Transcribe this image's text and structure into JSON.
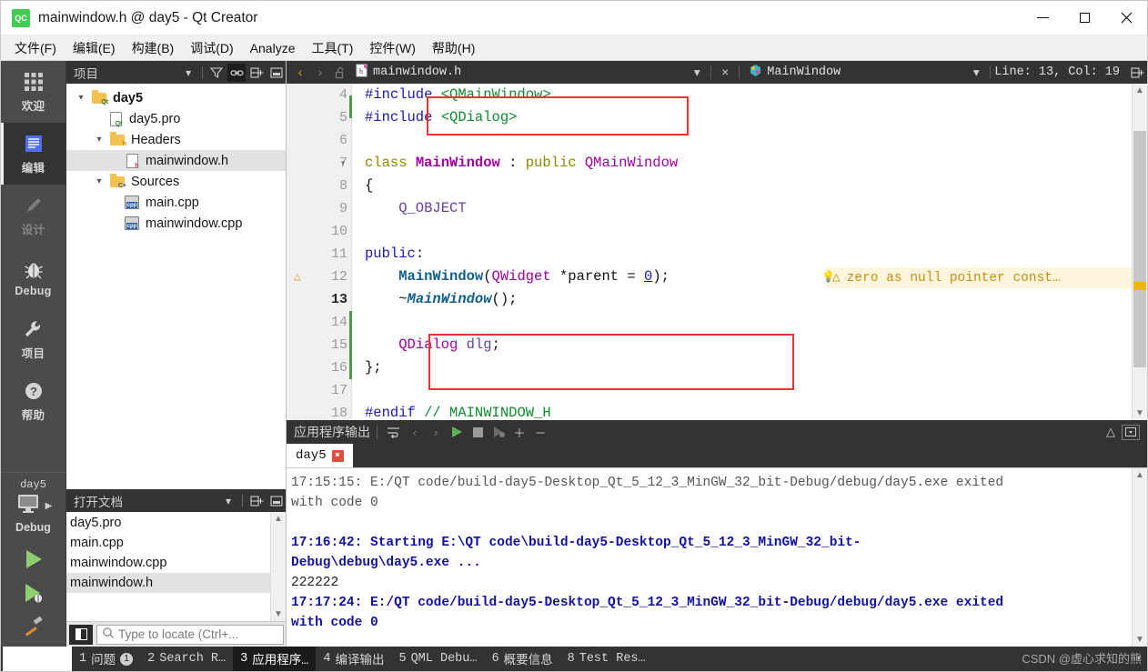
{
  "window": {
    "title": "mainwindow.h @ day5 - Qt Creator",
    "logo_text": "QC",
    "minimize_label": "minimize",
    "maximize_label": "maximize",
    "close_label": "close"
  },
  "menubar": [
    {
      "label": "文件(F)"
    },
    {
      "label": "编辑(E)"
    },
    {
      "label": "构建(B)"
    },
    {
      "label": "调试(D)"
    },
    {
      "label": "Analyze"
    },
    {
      "label": "工具(T)"
    },
    {
      "label": "控件(W)"
    },
    {
      "label": "帮助(H)"
    }
  ],
  "modebar": {
    "modes": [
      {
        "label": "欢迎",
        "icon": "grid-icon",
        "state": "normal"
      },
      {
        "label": "编辑",
        "icon": "edit-lines-icon",
        "state": "active"
      },
      {
        "label": "设计",
        "icon": "pencil-icon",
        "state": "disabled"
      },
      {
        "label": "Debug",
        "icon": "bug-icon",
        "state": "normal"
      },
      {
        "label": "项目",
        "icon": "wrench-icon",
        "state": "normal"
      },
      {
        "label": "帮助",
        "icon": "question-icon",
        "state": "normal"
      }
    ],
    "kit": {
      "project": "day5",
      "build_mode": "Debug",
      "target_icon": "monitor-icon"
    },
    "run_buttons": [
      {
        "name": "run-button",
        "icon": "play-icon"
      },
      {
        "name": "debug-button",
        "icon": "play-bug-icon"
      },
      {
        "name": "build-button",
        "icon": "hammer-icon"
      }
    ]
  },
  "project_pane": {
    "title": "项目",
    "toolbar": [
      {
        "name": "filter-icon"
      },
      {
        "name": "link-icon"
      },
      {
        "name": "split-icon"
      },
      {
        "name": "close-pane-icon"
      }
    ],
    "tree": [
      {
        "label": "day5",
        "indent": 0,
        "twisty": "v",
        "icon": "qt-folder-icon",
        "bold": true,
        "selected": false
      },
      {
        "label": "day5.pro",
        "indent": 1,
        "twisty": "",
        "icon": "pro-file-icon",
        "bold": false,
        "selected": false
      },
      {
        "label": "Headers",
        "indent": 1,
        "twisty": "v",
        "icon": "h-folder-icon",
        "bold": false,
        "selected": false
      },
      {
        "label": "mainwindow.h",
        "indent": 2,
        "twisty": "",
        "icon": "h-file-icon",
        "bold": false,
        "selected": true
      },
      {
        "label": "Sources",
        "indent": 1,
        "twisty": "v",
        "icon": "cpp-folder-icon",
        "bold": false,
        "selected": false
      },
      {
        "label": "main.cpp",
        "indent": 2,
        "twisty": "",
        "icon": "cpp-file-icon",
        "bold": false,
        "selected": false
      },
      {
        "label": "mainwindow.cpp",
        "indent": 2,
        "twisty": "",
        "icon": "cpp-file-icon",
        "bold": false,
        "selected": false
      }
    ]
  },
  "open_documents": {
    "title": "打开文档",
    "items": [
      {
        "label": "day5.pro",
        "selected": false
      },
      {
        "label": "main.cpp",
        "selected": false
      },
      {
        "label": "mainwindow.cpp",
        "selected": false
      },
      {
        "label": "mainwindow.h",
        "selected": true
      }
    ]
  },
  "locator": {
    "placeholder": "Type to locate (Ctrl+...",
    "icon": "search-icon",
    "toggle_icon": "sidebar-toggle-icon"
  },
  "editor_toolbar": {
    "back_label": "‹",
    "forward_label": "›",
    "lock_icon": "unlock-icon",
    "file_icon": "h-file-icon",
    "file_name": "mainwindow.h",
    "close_label": "×",
    "symbol_icon": "class-icon",
    "symbol_name": "MainWindow",
    "position": "Line: 13, Col: 19",
    "split_icon": "split-icon"
  },
  "code": {
    "lines": [
      {
        "no": "4",
        "marker": "",
        "fold": "",
        "current": false,
        "changed": false,
        "tokens": [
          {
            "t": "#include ",
            "c": "k-pre"
          },
          {
            "t": "<QMainWindow>",
            "c": "k-str"
          }
        ]
      },
      {
        "no": "5",
        "marker": "",
        "fold": "",
        "current": false,
        "changed": false,
        "cursor": true,
        "tokens": [
          {
            "t": "#include ",
            "c": "k-pre"
          },
          {
            "t": "<QDialog>",
            "c": "k-str"
          }
        ]
      },
      {
        "no": "6",
        "marker": "",
        "fold": "",
        "current": false,
        "changed": false,
        "tokens": []
      },
      {
        "no": "7",
        "marker": "",
        "fold": "v",
        "current": false,
        "changed": false,
        "tokens": [
          {
            "t": "class ",
            "c": "k-key"
          },
          {
            "t": "MainWindow",
            "c": "k-type"
          },
          {
            "t": " : ",
            "c": "k-plain"
          },
          {
            "t": "public ",
            "c": "k-key"
          },
          {
            "t": "QMainWindow",
            "c": "k-typen"
          }
        ]
      },
      {
        "no": "8",
        "marker": "",
        "fold": "",
        "current": false,
        "changed": false,
        "tokens": [
          {
            "t": "{",
            "c": "k-plain"
          }
        ]
      },
      {
        "no": "9",
        "marker": "",
        "fold": "",
        "current": false,
        "changed": false,
        "tokens": [
          {
            "t": "    Q_OBJECT",
            "c": "k-var"
          }
        ]
      },
      {
        "no": "10",
        "marker": "",
        "fold": "",
        "current": false,
        "changed": false,
        "tokens": []
      },
      {
        "no": "11",
        "marker": "",
        "fold": "",
        "current": false,
        "changed": false,
        "tokens": [
          {
            "t": "public",
            "c": "k-pre"
          },
          {
            "t": ":",
            "c": "k-plain"
          }
        ]
      },
      {
        "no": "12",
        "marker": "warn",
        "fold": "",
        "current": false,
        "changed": false,
        "tokens": [
          {
            "t": "    ",
            "c": "k-plain"
          },
          {
            "t": "MainWindow",
            "c": "k-fn"
          },
          {
            "t": "(",
            "c": "k-plain"
          },
          {
            "t": "QWidget",
            "c": "k-typen"
          },
          {
            "t": " *parent = ",
            "c": "k-plain"
          },
          {
            "t": "0",
            "c": "k-num"
          },
          {
            "t": ");",
            "c": "k-plain"
          }
        ]
      },
      {
        "no": "13",
        "marker": "",
        "fold": "",
        "current": true,
        "changed": false,
        "tokens": [
          {
            "t": "    ~",
            "c": "k-plain"
          },
          {
            "t": "MainWindow",
            "c": "k-fni"
          },
          {
            "t": "();",
            "c": "k-plain"
          }
        ]
      },
      {
        "no": "14",
        "marker": "",
        "fold": "",
        "current": false,
        "changed": true,
        "tokens": []
      },
      {
        "no": "15",
        "marker": "",
        "fold": "",
        "current": false,
        "changed": true,
        "tokens": [
          {
            "t": "    ",
            "c": "k-plain"
          },
          {
            "t": "QDialog",
            "c": "k-typen"
          },
          {
            "t": " ",
            "c": "k-plain"
          },
          {
            "t": "dlg",
            "c": "k-var"
          },
          {
            "t": ";",
            "c": "k-plain"
          }
        ]
      },
      {
        "no": "16",
        "marker": "",
        "fold": "",
        "current": false,
        "changed": true,
        "tokens": [
          {
            "t": "};",
            "c": "k-plain"
          }
        ]
      },
      {
        "no": "17",
        "marker": "",
        "fold": "",
        "current": false,
        "changed": false,
        "tokens": []
      },
      {
        "no": "18",
        "marker": "",
        "fold": "",
        "current": false,
        "changed": false,
        "tokens": [
          {
            "t": "#endif ",
            "c": "k-pre"
          },
          {
            "t": "// MAINWINDOW_H",
            "c": "k-cmt"
          }
        ]
      }
    ],
    "inline_warning": {
      "icon": "warning-triangle-icon",
      "text": "zero as null pointer const…",
      "bulb_icon": "lightbulb-icon"
    }
  },
  "output_pane": {
    "title": "应用程序输出",
    "toolbar": [
      {
        "name": "wrap-lines-icon"
      },
      {
        "name": "prev-item-icon"
      },
      {
        "name": "next-item-icon"
      },
      {
        "name": "run-icon"
      },
      {
        "name": "stop-icon"
      },
      {
        "name": "attach-debugger-icon"
      },
      {
        "name": "zoom-in-icon"
      },
      {
        "name": "zoom-out-icon"
      }
    ],
    "right_toolbar": [
      {
        "name": "collapse-icon"
      },
      {
        "name": "maximize-pane-icon"
      }
    ],
    "tab": {
      "label": "day5",
      "close_icon": "close-icon"
    },
    "lines": [
      {
        "text": "17:15:15: E:/QT code/build-day5-Desktop_Qt_5_12_3_MinGW_32_bit-Debug/debug/day5.exe exited",
        "style": "ln-gray"
      },
      {
        "text": "with code 0",
        "style": "ln-gray"
      },
      {
        "text": "",
        "style": "ln-gray"
      },
      {
        "text": "17:16:42: Starting E:\\QT code\\build-day5-Desktop_Qt_5_12_3_MinGW_32_bit-",
        "style": "ln-blue"
      },
      {
        "text": "Debug\\debug\\day5.exe ...",
        "style": "ln-blue"
      },
      {
        "text": "222222",
        "style": "ln-plain"
      },
      {
        "text": "17:17:24: E:/QT code/build-day5-Desktop_Qt_5_12_3_MinGW_32_bit-Debug/debug/day5.exe exited",
        "style": "ln-blue"
      },
      {
        "text": "with code 0",
        "style": "ln-blue"
      }
    ]
  },
  "statusbar": {
    "items": [
      {
        "num": "1",
        "label": "问题",
        "badge": "1",
        "active": false
      },
      {
        "num": "2",
        "label": "Search R…",
        "badge": "",
        "active": false
      },
      {
        "num": "3",
        "label": "应用程序…",
        "badge": "",
        "active": true
      },
      {
        "num": "4",
        "label": "编译输出",
        "badge": "",
        "active": false
      },
      {
        "num": "5",
        "label": "QML Debu…",
        "badge": "",
        "active": false
      },
      {
        "num": "6",
        "label": "概要信息",
        "badge": "",
        "active": false
      },
      {
        "num": "8",
        "label": "Test Res…",
        "badge": "",
        "active": false
      }
    ],
    "watermark": "CSDN @虚心求知的熊"
  },
  "colors": {
    "accent_green": "#41cd52",
    "dark_chrome": "#333333",
    "mode_bar": "#4b4b4b",
    "selection": "#e2e2e2",
    "warning": "#d8a33a",
    "red_annotation": "#e33333",
    "output_blue": "#12129c"
  }
}
